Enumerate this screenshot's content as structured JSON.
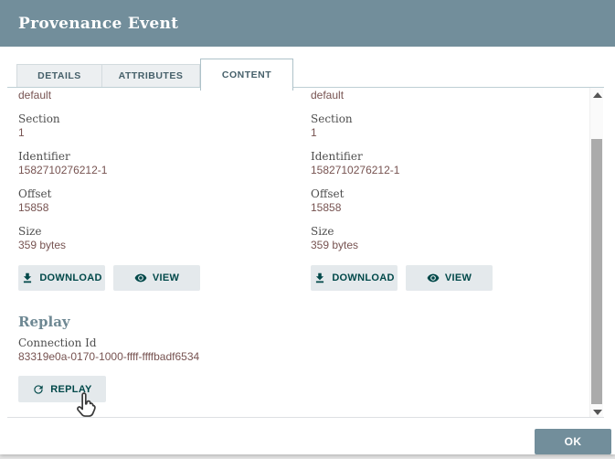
{
  "window": {
    "title": "Provenance Event",
    "ok_label": "OK"
  },
  "tabs": {
    "active": "CONTENT",
    "items": [
      {
        "label": "DETAILS"
      },
      {
        "label": "ATTRIBUTES"
      },
      {
        "label": "CONTENT"
      }
    ]
  },
  "claim": {
    "partial_value": "default",
    "fields": [
      {
        "label": "Section",
        "value": "1"
      },
      {
        "label": "Identifier",
        "value": "1582710276212-1"
      },
      {
        "label": "Offset",
        "value": "15858"
      },
      {
        "label": "Size",
        "value": "359 bytes"
      }
    ],
    "download_label": "DOWNLOAD",
    "view_label": "VIEW"
  },
  "replay": {
    "heading": "Replay",
    "connection_label": "Connection Id",
    "connection_value": "83319e0a-0170-1000-ffff-ffffbadf6534",
    "replay_label": "REPLAY"
  },
  "icons": {
    "download": "download-icon",
    "view": "eye-icon",
    "replay": "refresh-icon",
    "cursor": "hand-pointer-cursor"
  },
  "colors": {
    "header_bg": "#728E9B",
    "accent_teal": "#004849",
    "value_text": "#775351",
    "label_text": "#4E4E4E",
    "button_bg": "#E4E9EC",
    "heading_text": "#6E8893"
  }
}
